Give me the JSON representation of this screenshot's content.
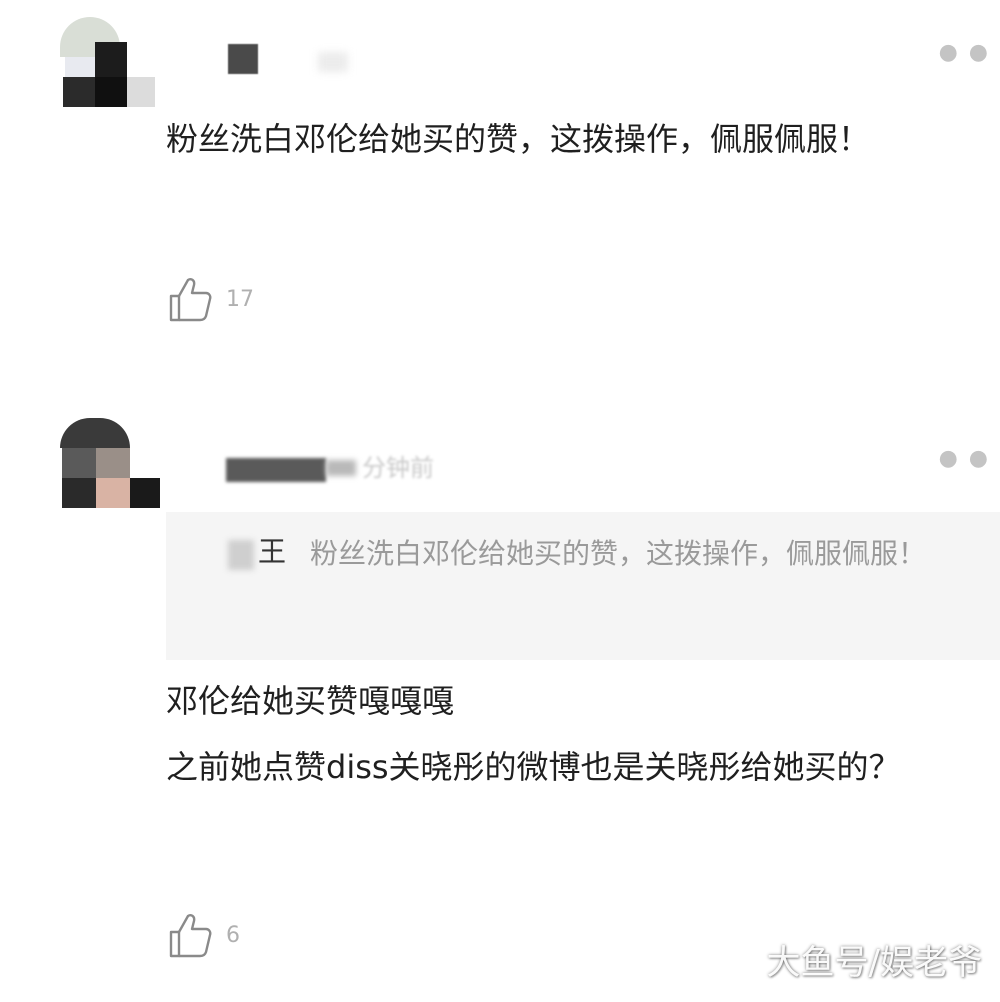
{
  "comments": [
    {
      "text": "粉丝洗白邓伦给她买的赞，这拨操作，佩服佩服！",
      "likes": "17"
    },
    {
      "time": "分钟前",
      "quote": {
        "author": "王",
        "text": "粉丝洗白邓伦给她买的赞，这拨操作，佩服佩服！"
      },
      "text": "邓伦给她买赞嘎嘎嘎\n之前她点赞diss关晓彤的微博也是关晓彤给她买的？",
      "likes": "6"
    }
  ],
  "icons": {
    "like": "thumbs-up-icon",
    "more": "more-dots-icon"
  },
  "watermark": "大鱼号/娱老爷"
}
